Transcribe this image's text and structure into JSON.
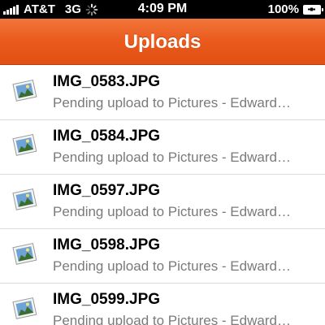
{
  "status_bar": {
    "carrier": "AT&T",
    "network": "3G",
    "time": "4:09 PM",
    "battery": "100%"
  },
  "nav": {
    "title": "Uploads",
    "color": "#ea5a1d"
  },
  "uploads": [
    {
      "filename": "IMG_0583.JPG",
      "status": "Pending upload to Pictures - Edward…",
      "icon": "photo-file-icon"
    },
    {
      "filename": "IMG_0584.JPG",
      "status": "Pending upload to Pictures - Edward…",
      "icon": "photo-file-icon"
    },
    {
      "filename": "IMG_0597.JPG",
      "status": "Pending upload to Pictures - Edward…",
      "icon": "photo-file-icon"
    },
    {
      "filename": "IMG_0598.JPG",
      "status": "Pending upload to Pictures - Edward…",
      "icon": "photo-file-icon"
    },
    {
      "filename": "IMG_0599.JPG",
      "status": "Pending upload to Pictures - Edward…",
      "icon": "photo-file-icon"
    }
  ]
}
